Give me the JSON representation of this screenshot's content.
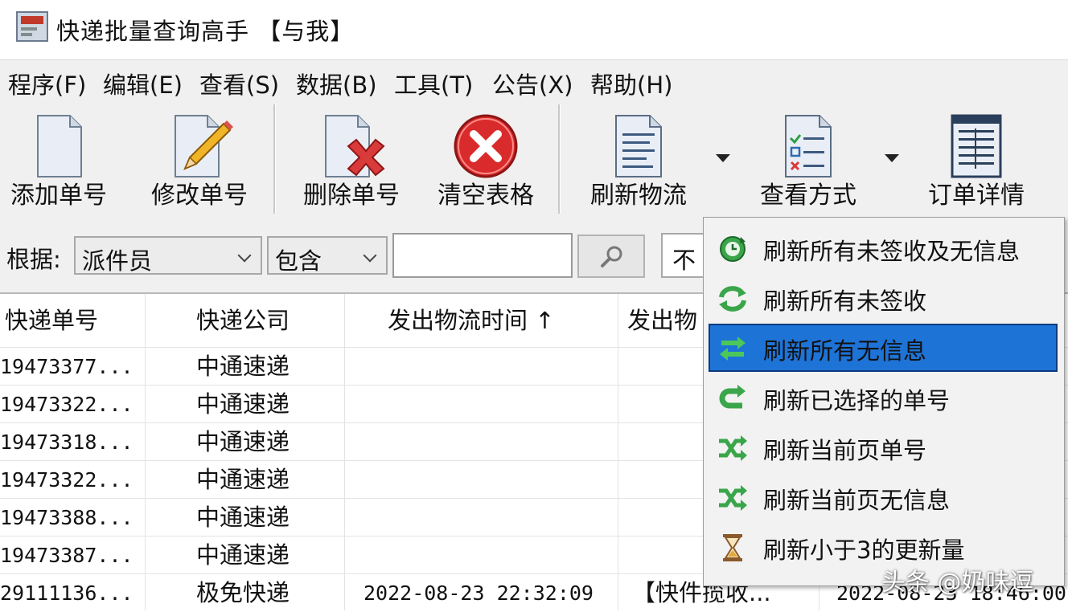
{
  "window": {
    "title": "快递批量查询高手 【与我】"
  },
  "menu": [
    "程序(F)",
    "编辑(E)",
    "查看(S)",
    "数据(B)",
    "工具(T)",
    "公告(X)",
    "帮助(H)"
  ],
  "toolbar": {
    "add": "添加单号",
    "edit": "修改单号",
    "delete": "删除单号",
    "clear": "清空表格",
    "refresh": "刷新物流",
    "view": "查看方式",
    "detail": "订单详情"
  },
  "filter": {
    "label": "根据:",
    "field_value": "派件员",
    "op_value": "包含",
    "query_value": "",
    "partial_value": "不"
  },
  "grid": {
    "headers": [
      "快递单号",
      "快递公司",
      "发出物流时间 ↑",
      "发出物"
    ],
    "rows": [
      [
        "19473377...",
        "中通速递",
        "",
        ""
      ],
      [
        "19473322...",
        "中通速递",
        "",
        ""
      ],
      [
        "19473318...",
        "中通速递",
        "",
        ""
      ],
      [
        "19473322...",
        "中通速递",
        "",
        ""
      ],
      [
        "19473388...",
        "中通速递",
        "",
        ""
      ],
      [
        "19473387...",
        "中通速递",
        "",
        ""
      ],
      [
        "29111136...",
        "极免快递",
        "2022-08-23 22:32:09",
        "【快件揽收..."
      ]
    ],
    "partial_last_cell": "2022-08-23 18:46:00"
  },
  "dropdown": {
    "selected_index": 2,
    "items": [
      {
        "label": "刷新所有未签收及无信息",
        "icon": "refresh-clock-icon"
      },
      {
        "label": "刷新所有未签收",
        "icon": "refresh-arrows-icon"
      },
      {
        "label": "刷新所有无信息",
        "icon": "refresh-swap-icon"
      },
      {
        "label": "刷新已选择的单号",
        "icon": "refresh-loop-icon"
      },
      {
        "label": "刷新当前页单号",
        "icon": "shuffle-icon"
      },
      {
        "label": "刷新当前页无信息",
        "icon": "shuffle-icon"
      },
      {
        "label": "刷新小于3的更新量",
        "icon": "hourglass-icon"
      }
    ]
  },
  "watermark": "头条 @奶味逗",
  "colors": {
    "menu_bg": "#f0f0f0",
    "selection": "#1e73d6",
    "selection_border": "#0d3a7e",
    "icon_green": "#3aa54a"
  }
}
